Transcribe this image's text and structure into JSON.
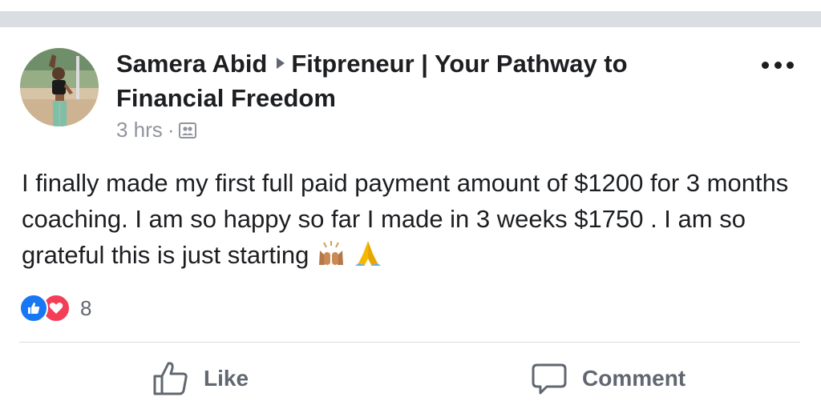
{
  "post": {
    "author": "Samera Abid",
    "group": "Fitpreneur | Your Pathway to Financial Freedom",
    "time": "3 hrs",
    "separator": "·",
    "audience_icon": "group-audience-icon",
    "body": "I finally made my first full paid payment amount of $1200 for 3 months coaching. I am so happy so far I made in 3 weeks $1750 . I am so grateful this is just starting",
    "emojis": [
      "raising-hands-emoji",
      "folded-hands-emoji"
    ],
    "reactions": {
      "types": [
        "like",
        "love"
      ],
      "count": "8"
    }
  },
  "actions": {
    "like_label": "Like",
    "comment_label": "Comment"
  },
  "colors": {
    "like_blue": "#1877f2",
    "love_red": "#f33e58",
    "text": "#1c1e21",
    "secondary": "#606770",
    "muted": "#90949c"
  }
}
